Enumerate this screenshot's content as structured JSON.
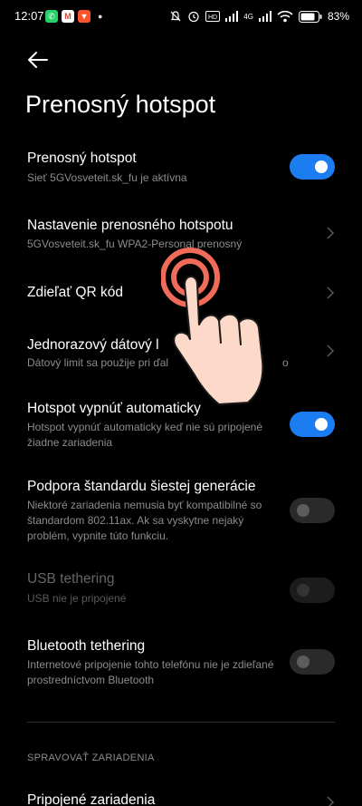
{
  "status_bar": {
    "time": "12:07",
    "battery_percent": "83%",
    "network_label": "4G"
  },
  "header": {
    "title": "Prenosný hotspot"
  },
  "settings": [
    {
      "title": "Prenosný hotspot",
      "subtitle": "Sieť 5GVosveteit.sk_fu je aktívna",
      "control": "toggle",
      "state": "on"
    },
    {
      "title": "Nastavenie prenosného hotspotu",
      "subtitle": "5GVosveteit.sk_fu WPA2-Personal prenosný",
      "control": "chevron"
    },
    {
      "title": "Zdieľať QR kód",
      "subtitle": "",
      "control": "chevron"
    },
    {
      "title": "Jednorazový dátový l",
      "subtitle": "Dátový limit sa použije pri ďal",
      "subtitle_tail": "o",
      "control": "chevron"
    },
    {
      "title": "Hotspot vypnúť automaticky",
      "subtitle": "Hotspot vypnúť automaticky keď nie sú pripojené žiadne zariadenia",
      "control": "toggle",
      "state": "on"
    },
    {
      "title": "Podpora štandardu šiestej generácie",
      "subtitle": "Niektoré zariadenia nemusia byť kompatibilné so štandardom 802.11ax. Ak sa vyskytne nejaký problém, vypnite túto funkciu.",
      "control": "toggle",
      "state": "off"
    },
    {
      "title": "USB tethering",
      "subtitle": "USB nie je pripojené",
      "control": "toggle",
      "state": "disabled"
    },
    {
      "title": "Bluetooth tethering",
      "subtitle": "Internetové pripojenie tohto telefónu nie je zdieľané prostredníctvom Bluetooth",
      "control": "toggle",
      "state": "off"
    }
  ],
  "section": {
    "header": "SPRAVOVAŤ ZARIADENIA",
    "item_title": "Pripojené zariadenia"
  },
  "colors": {
    "accent": "#1c7df0",
    "background": "#000000",
    "tap_ring": "#f06b5a"
  },
  "icons": [
    "whatsapp-icon",
    "gmail-icon",
    "brave-icon",
    "mute-icon",
    "alarm-icon",
    "volte-icon",
    "signal-icon",
    "wifi-icon",
    "battery-icon",
    "back-arrow-icon",
    "chevron-right-icon",
    "tap-hand-icon"
  ]
}
